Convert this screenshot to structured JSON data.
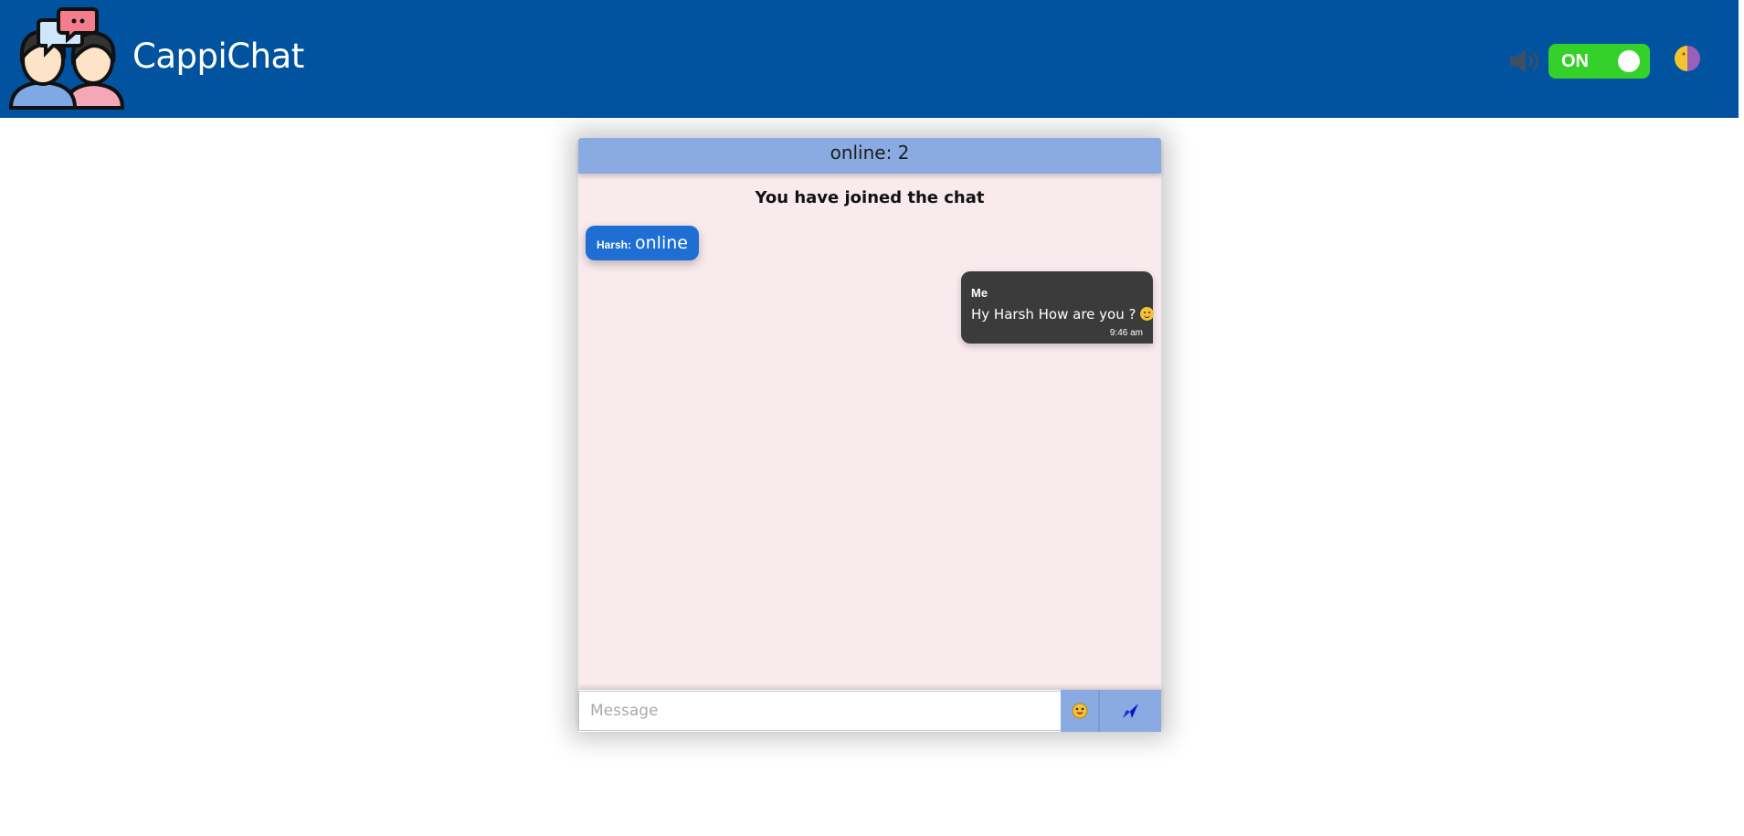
{
  "header": {
    "app_title": "CappiChat",
    "logo_icon": "chat-people-logo-icon",
    "sound_icon": "speaker-icon",
    "toggle_label": "ON",
    "theme_icon": "half-moon-theme-icon",
    "colors": {
      "bar": "#01539f",
      "toggle_on": "#34d12a"
    }
  },
  "chat": {
    "header_text": "online: 2",
    "join_notice": "You have joined the chat",
    "status": {
      "name": "Harsh",
      "separator": ":",
      "text": "online"
    },
    "messages": [
      {
        "sender": "Me",
        "text": "Hy Harsh How are you ?",
        "emoji_icon": "smiley-emoji-icon",
        "time": "9:46 am"
      }
    ],
    "composer": {
      "placeholder": "Message",
      "value": "",
      "emoji_button_icon": "smiley-emoji-icon",
      "send_button_icon": "send-arrow-icon"
    },
    "colors": {
      "panel_bg": "#f8eaed",
      "header_bg": "#8aabe1",
      "status_bubble": "#1e6ed4",
      "my_bubble": "#3b3b3b"
    }
  }
}
